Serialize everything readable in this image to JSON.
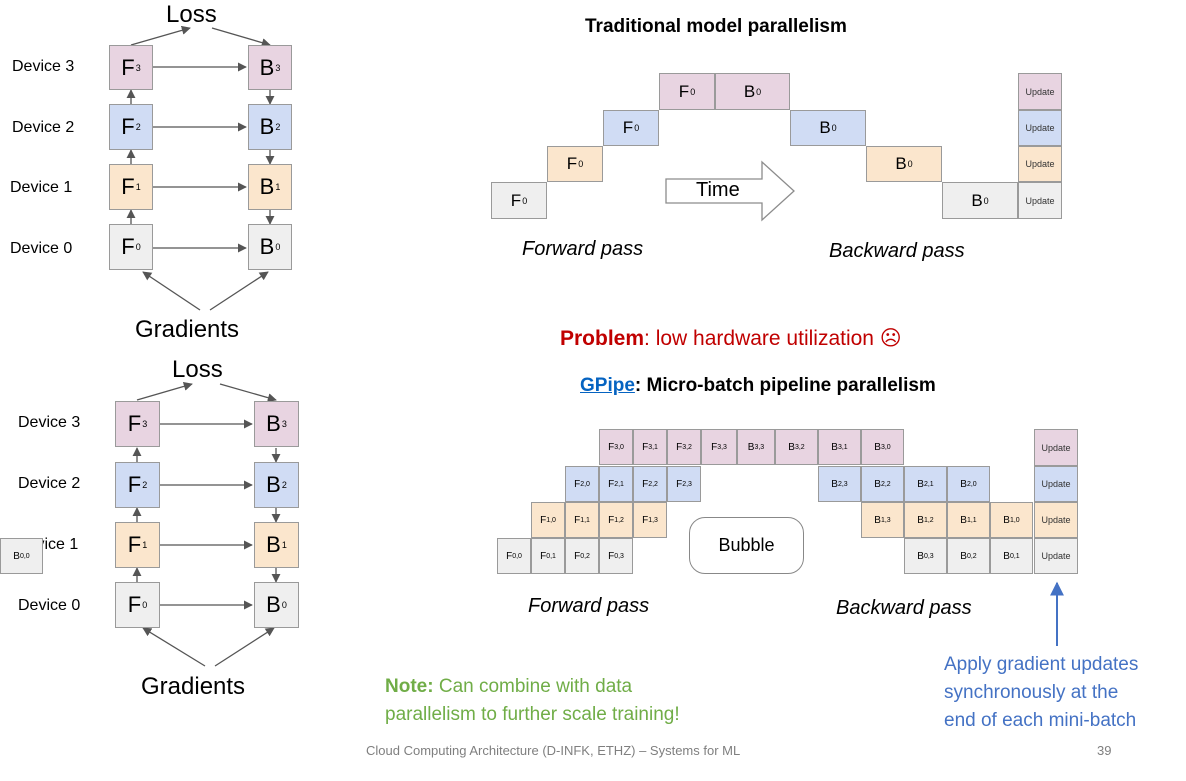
{
  "top_diagram": {
    "loss_label": "Loss",
    "gradients_label": "Gradients",
    "devices": [
      "Device 3",
      "Device 2",
      "Device 1",
      "Device 0"
    ]
  },
  "bottom_diagram": {
    "loss_label": "Loss",
    "gradients_label": "Gradients",
    "devices": [
      "Device 3",
      "Device 2",
      "Device 1",
      "Device 0"
    ]
  },
  "node_text": {
    "forward_letter": "F",
    "backward_letter": "B",
    "update_label": "Update"
  },
  "traditional": {
    "title": "Traditional model parallelism",
    "time_label": "Time",
    "forward_pass": "Forward pass",
    "backward_pass": "Backward pass"
  },
  "problem": {
    "keyword": "Problem",
    "text": ": low hardware utilization ☹"
  },
  "gpipe": {
    "link_text": "GPipe",
    "title_rest": ": Micro-batch pipeline parallelism",
    "bubble_label": "Bubble",
    "forward_pass": "Forward pass",
    "backward_pass": "Backward pass"
  },
  "note": {
    "keyword": "Note:",
    "line1": " Can combine with data",
    "line2": "parallelism to further scale training!"
  },
  "annotation": {
    "line1": "Apply gradient updates",
    "line2": "synchronously at the",
    "line3": "end of each mini-batch"
  },
  "footer": {
    "text": "Cloud Computing Architecture (D-INFK, ETHZ) – Systems for ML",
    "page_number": "39"
  },
  "colors": {
    "device0": "#efefef",
    "device1": "#fbe6cd",
    "device2": "#d0dcf4",
    "device3": "#e8d4e1",
    "problem_red": "#c00000",
    "note_green": "#70ad47",
    "annotation_blue": "#4472c4",
    "link_blue": "#0563c1"
  }
}
